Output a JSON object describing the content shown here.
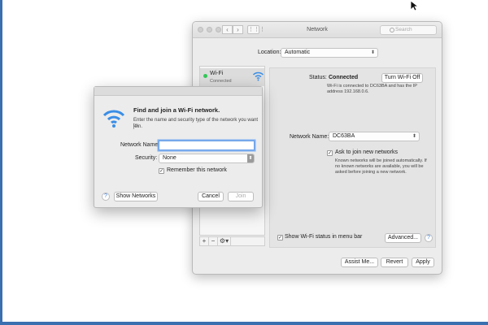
{
  "window": {
    "title": "Network",
    "search_placeholder": "Search",
    "location_label": "Location:",
    "location_value": "Automatic",
    "sidebar": {
      "items": [
        {
          "name": "Wi-Fi",
          "status": "Connected"
        }
      ],
      "tools": [
        "+",
        "−",
        "⚙▾"
      ]
    },
    "panel": {
      "status_label": "Status:",
      "status_value": "Connected",
      "turn_off_button": "Turn Wi-Fi Off",
      "status_detail_1": "Wi-Fi is connected to DC63BA and has the IP",
      "status_detail_2": "address 192.168.0.6.",
      "network_name_label": "Network Name:",
      "network_name_value": "DC63BA",
      "ask_join_label": "Ask to join new networks",
      "ask_join_checked": true,
      "ask_join_detail_1": "Known networks will be joined automatically. If",
      "ask_join_detail_2": "no known networks are available, you will be",
      "ask_join_detail_3": "asked before joining a new network.",
      "show_status_label": "Show Wi-Fi status in menu bar",
      "show_status_checked": true,
      "advanced_button": "Advanced...",
      "help": "?"
    },
    "footer": {
      "assist_button": "Assist Me...",
      "revert_button": "Revert",
      "apply_button": "Apply"
    }
  },
  "dialog": {
    "title": "Find and join a Wi-Fi network.",
    "description_1": "Enter the name and security type of the network you want to",
    "description_2": "join.",
    "network_name_label": "Network Name:",
    "network_name_value": "",
    "security_label": "Security:",
    "security_value": "None",
    "remember_label": "Remember this network",
    "remember_checked": true,
    "help": "?",
    "show_networks_button": "Show Networks",
    "cancel_button": "Cancel",
    "join_button": "Join"
  },
  "colors": {
    "accent": "#3a7bd5",
    "connected_dot": "#34c759",
    "desktop_edge": "#3a6fb0"
  }
}
